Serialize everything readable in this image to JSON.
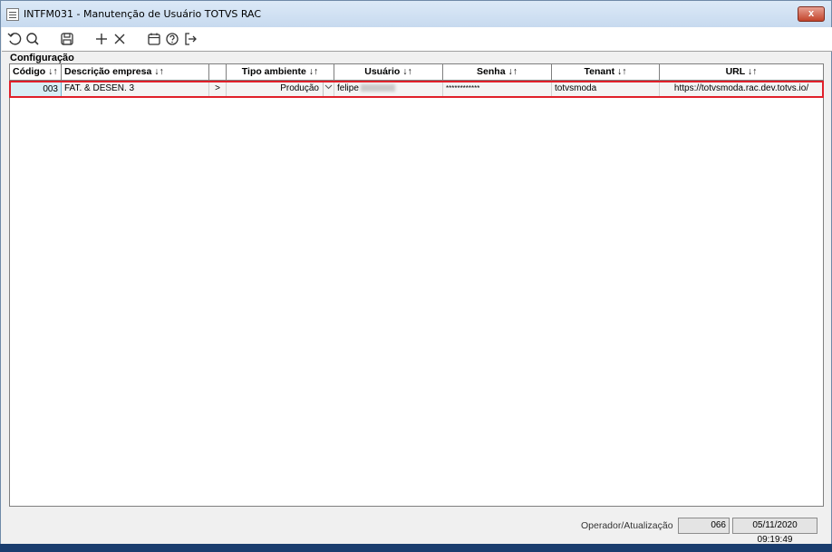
{
  "window": {
    "title": "INTFM031 - Manutenção de Usuário TOTVS RAC",
    "close_label": "x"
  },
  "toolbar": {
    "icons": [
      "undo-icon",
      "search-icon",
      "save-icon",
      "add-icon",
      "delete-icon",
      "calendar-icon",
      "help-icon",
      "exit-icon"
    ]
  },
  "section": {
    "label": "Configuração"
  },
  "grid": {
    "columns": [
      "Código ↓↑",
      "Descrição empresa ↓↑",
      "",
      "Tipo ambiente ↓↑",
      "Usuário ↓↑",
      "Senha ↓↑",
      "Tenant ↓↑",
      "URL ↓↑"
    ],
    "rows": [
      {
        "codigo": "003",
        "descricao": "FAT. & DESEN. 3",
        "expand": ">",
        "tipo_ambiente": "Produção",
        "usuario": "felipe",
        "senha": "************",
        "tenant": "totvsmoda",
        "url": "https://totvsmoda.rac.dev.totvs.io/"
      }
    ]
  },
  "status": {
    "label": "Operador/Atualização",
    "operator": "066",
    "updated": "05/11/2020 09:19:49"
  },
  "colors": {
    "selection_border": "#e0202a",
    "title_gradient_top": "#dce9f7",
    "close_button": "#c2442b"
  }
}
